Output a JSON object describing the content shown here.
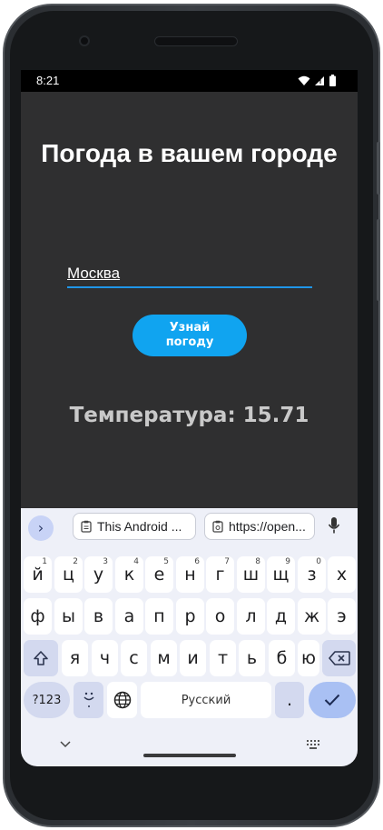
{
  "status_bar": {
    "time": "8:21"
  },
  "app": {
    "title": "Погода в вашем городе",
    "city_value": "Москва",
    "button_label": "Узнай\nпогоду",
    "temperature_text": "Температура: 15.71"
  },
  "keyboard": {
    "suggestions": [
      {
        "label": "This Android ..."
      },
      {
        "label": "https://open..."
      }
    ],
    "row1": [
      {
        "k": "й",
        "h": "1"
      },
      {
        "k": "ц",
        "h": "2"
      },
      {
        "k": "у",
        "h": "3"
      },
      {
        "k": "к",
        "h": "4"
      },
      {
        "k": "е",
        "h": "5"
      },
      {
        "k": "н",
        "h": "6"
      },
      {
        "k": "г",
        "h": "7"
      },
      {
        "k": "ш",
        "h": "8"
      },
      {
        "k": "щ",
        "h": "9"
      },
      {
        "k": "з",
        "h": "0"
      },
      {
        "k": "х",
        "h": ""
      }
    ],
    "row2": [
      "ф",
      "ы",
      "в",
      "а",
      "п",
      "р",
      "о",
      "л",
      "д",
      "ж",
      "э"
    ],
    "row3": [
      "я",
      "ч",
      "с",
      "м",
      "и",
      "т",
      "ь",
      "б",
      "ю"
    ],
    "symbols_label": "?123",
    "space_label": "Русский",
    "period_label": "."
  },
  "colors": {
    "screen_bg": "#2f2f30",
    "accent": "#10a4f0",
    "underline": "#1f96e9",
    "keyboard_bg": "#eef0f8"
  }
}
